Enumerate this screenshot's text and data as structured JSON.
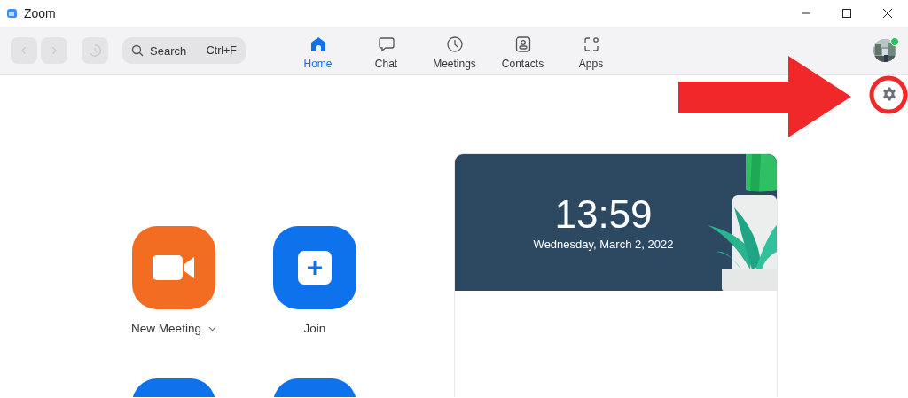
{
  "window": {
    "title": "Zoom"
  },
  "navigation": [
    {
      "kind": "back",
      "disabled": true
    },
    {
      "kind": "forward",
      "disabled": true
    },
    {
      "kind": "history",
      "disabled": true
    }
  ],
  "search": {
    "placeholder": "Search",
    "shortcut": "Ctrl+F"
  },
  "tabs": [
    {
      "label": "Home",
      "kind": "home",
      "selected": true
    },
    {
      "label": "Chat",
      "kind": "chat",
      "selected": false
    },
    {
      "label": "Meetings",
      "kind": "meetings",
      "selected": false
    },
    {
      "label": "Contacts",
      "kind": "contacts",
      "selected": false
    },
    {
      "label": "Apps",
      "kind": "apps",
      "selected": false
    }
  ],
  "user": {
    "online": true
  },
  "actions": [
    {
      "label": "New Meeting",
      "kind": "video",
      "color": "#f26d21",
      "has_menu": true
    },
    {
      "label": "Join",
      "kind": "join",
      "color": "#0e72ed",
      "has_menu": false
    },
    {
      "kind": "cut",
      "color": "#0e72ed"
    },
    {
      "kind": "cut",
      "color": "#0e72ed"
    }
  ],
  "clock": {
    "time": "13:59",
    "date": "Wednesday, March 2, 2022"
  }
}
